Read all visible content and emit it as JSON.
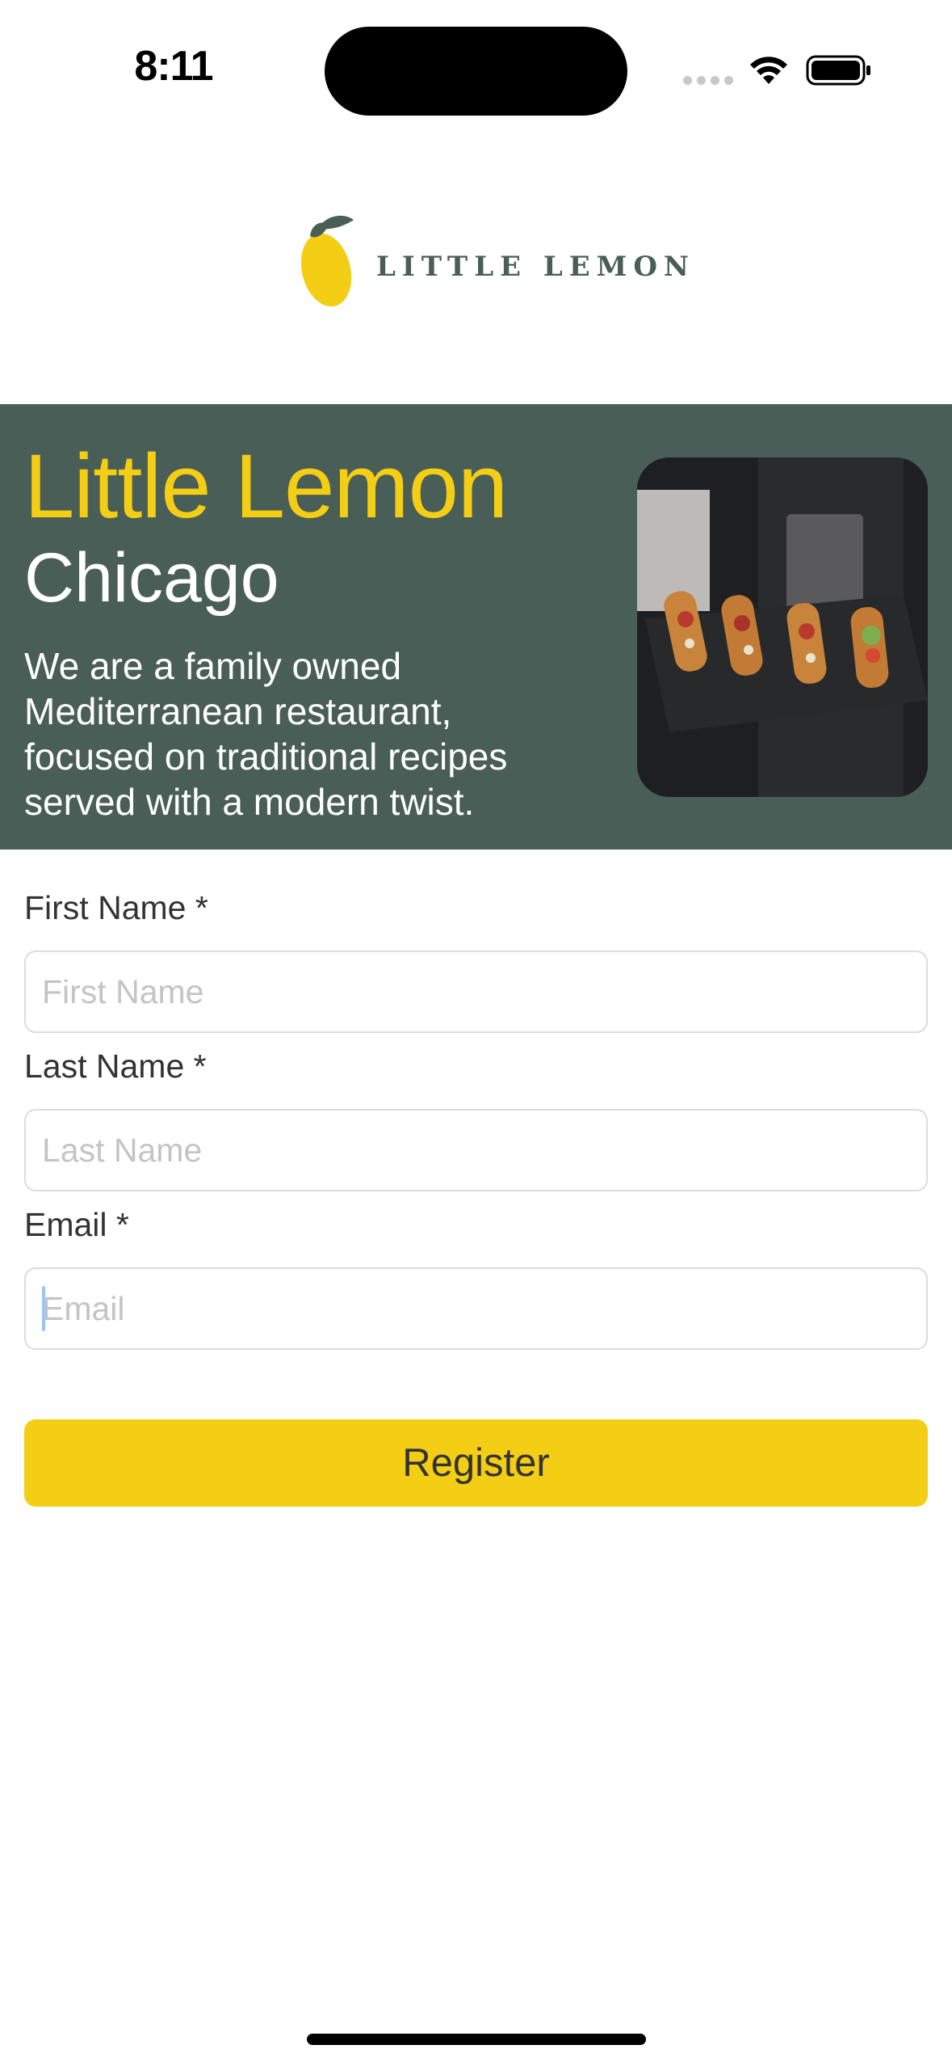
{
  "status_bar": {
    "time": "8:11"
  },
  "header": {
    "logo_text": "LITTLE LEMON",
    "logo_icon": "lemon-icon"
  },
  "hero": {
    "title": "Little Lemon",
    "subtitle": "Chicago",
    "description": "We are a family owned Mediterranean restaurant, focused on traditional recipes served with a modern twist.",
    "image": "food-tray-image"
  },
  "form": {
    "first_name": {
      "label": "First Name *",
      "placeholder": "First Name",
      "value": ""
    },
    "last_name": {
      "label": "Last Name *",
      "placeholder": "Last Name",
      "value": ""
    },
    "email": {
      "label": "Email *",
      "placeholder": "Email",
      "value": ""
    },
    "register_label": "Register"
  },
  "colors": {
    "brand_green": "#495e57",
    "brand_yellow": "#f4ce14",
    "text_dark": "#333333"
  }
}
